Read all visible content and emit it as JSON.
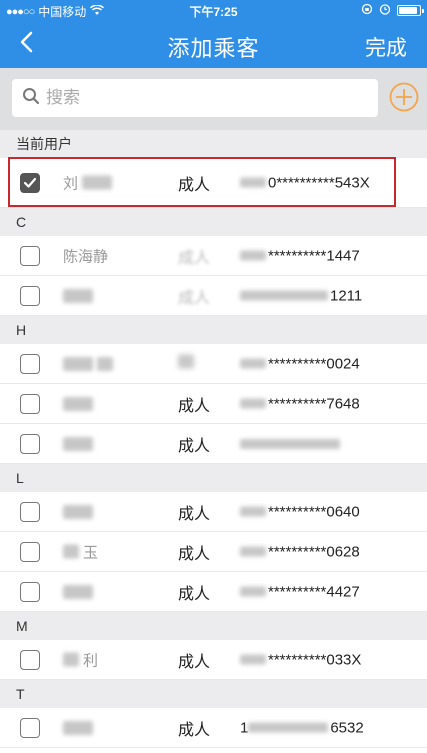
{
  "status_bar": {
    "signal": "●●●○○",
    "carrier": "中国移动",
    "wifi_icon": "wifi-icon",
    "time": "下午7:25",
    "lock_icon": "rotation-lock-icon",
    "alarm_icon": "alarm-icon",
    "battery_icon": "battery-icon"
  },
  "nav": {
    "title": "添加乘客",
    "back_icon": "chevron-left-icon",
    "done_label": "完成"
  },
  "search": {
    "placeholder": "搜索",
    "icon": "search-icon",
    "add_icon": "plus-circle-icon"
  },
  "colors": {
    "accent": "#2f8fe6",
    "add_button": "#f5a44a",
    "highlight": "#c8272c"
  },
  "sections": [
    {
      "header": "当前用户",
      "rows": [
        {
          "name": "刘",
          "type": "成人",
          "id_prefix": "0",
          "id_suffix": "**********543X",
          "checked": true
        }
      ]
    },
    {
      "header": "C",
      "rows": [
        {
          "name": "陈海静",
          "type": "成人",
          "id_prefix": "",
          "id_suffix": "**********1447",
          "checked": false
        },
        {
          "name": "",
          "type": "成人",
          "id_prefix": "",
          "id_suffix": "1211",
          "checked": false
        }
      ]
    },
    {
      "header": "H",
      "rows": [
        {
          "name": "",
          "type": "",
          "id_prefix": "",
          "id_suffix": "**********0024",
          "checked": false
        },
        {
          "name": "",
          "type": "成人",
          "id_prefix": "",
          "id_suffix": "**********7648",
          "checked": false
        },
        {
          "name": "",
          "type": "成人",
          "id_prefix": "",
          "id_suffix": "",
          "checked": false
        }
      ]
    },
    {
      "header": "L",
      "rows": [
        {
          "name": "",
          "type": "成人",
          "id_prefix": "",
          "id_suffix": "**********0640",
          "checked": false
        },
        {
          "name": "玉",
          "type": "成人",
          "id_prefix": "",
          "id_suffix": "**********0628",
          "checked": false
        },
        {
          "name": "",
          "type": "成人",
          "id_prefix": "",
          "id_suffix": "**********4427",
          "checked": false
        }
      ]
    },
    {
      "header": "M",
      "rows": [
        {
          "name": "利",
          "type": "成人",
          "id_prefix": "",
          "id_suffix": "**********033X",
          "checked": false
        }
      ]
    },
    {
      "header": "T",
      "rows": [
        {
          "name": "",
          "type": "成人",
          "id_prefix": "1",
          "id_suffix": "6532",
          "checked": false
        }
      ]
    }
  ]
}
